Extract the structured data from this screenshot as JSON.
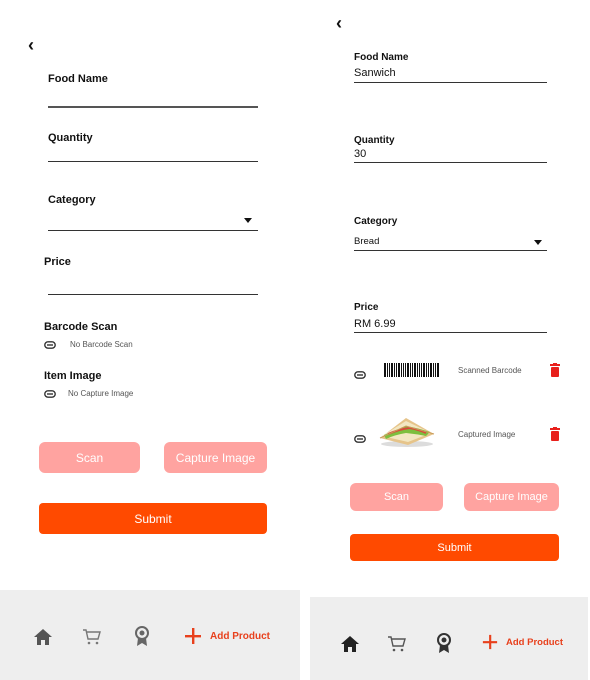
{
  "left": {
    "back_glyph": "‹",
    "food_name_label": "Food Name",
    "food_name_value": "",
    "quantity_label": "Quantity",
    "quantity_value": "",
    "category_label": "Category",
    "category_value": "",
    "price_label": "Price",
    "price_value": "",
    "barcode_heading": "Barcode Scan",
    "barcode_status": "No Barcode Scan",
    "image_heading": "Item Image",
    "image_status": "No Capture Image",
    "scan_button": "Scan",
    "capture_button": "Capture Image",
    "submit_button": "Submit"
  },
  "right": {
    "back_glyph": "‹",
    "food_name_label": "Food Name",
    "food_name_value": "Sanwich",
    "quantity_label": "Quantity",
    "quantity_value": "30",
    "category_label": "Category",
    "category_value": "Bread",
    "price_label": "Price",
    "price_value": "RM 6.99",
    "barcode_caption": "Scanned Barcode",
    "image_caption": "Captured Image",
    "scan_button": "Scan",
    "capture_button": "Capture Image",
    "submit_button": "Submit"
  },
  "nav": {
    "add_product_label": "Add Product",
    "items": [
      "home-icon",
      "cart-icon",
      "award-icon",
      "plus-icon"
    ]
  },
  "colors": {
    "accent": "#ff4a00",
    "accent_light": "#ffa3a0",
    "delete": "#e8201c",
    "nav_bg": "#eeeeee"
  }
}
